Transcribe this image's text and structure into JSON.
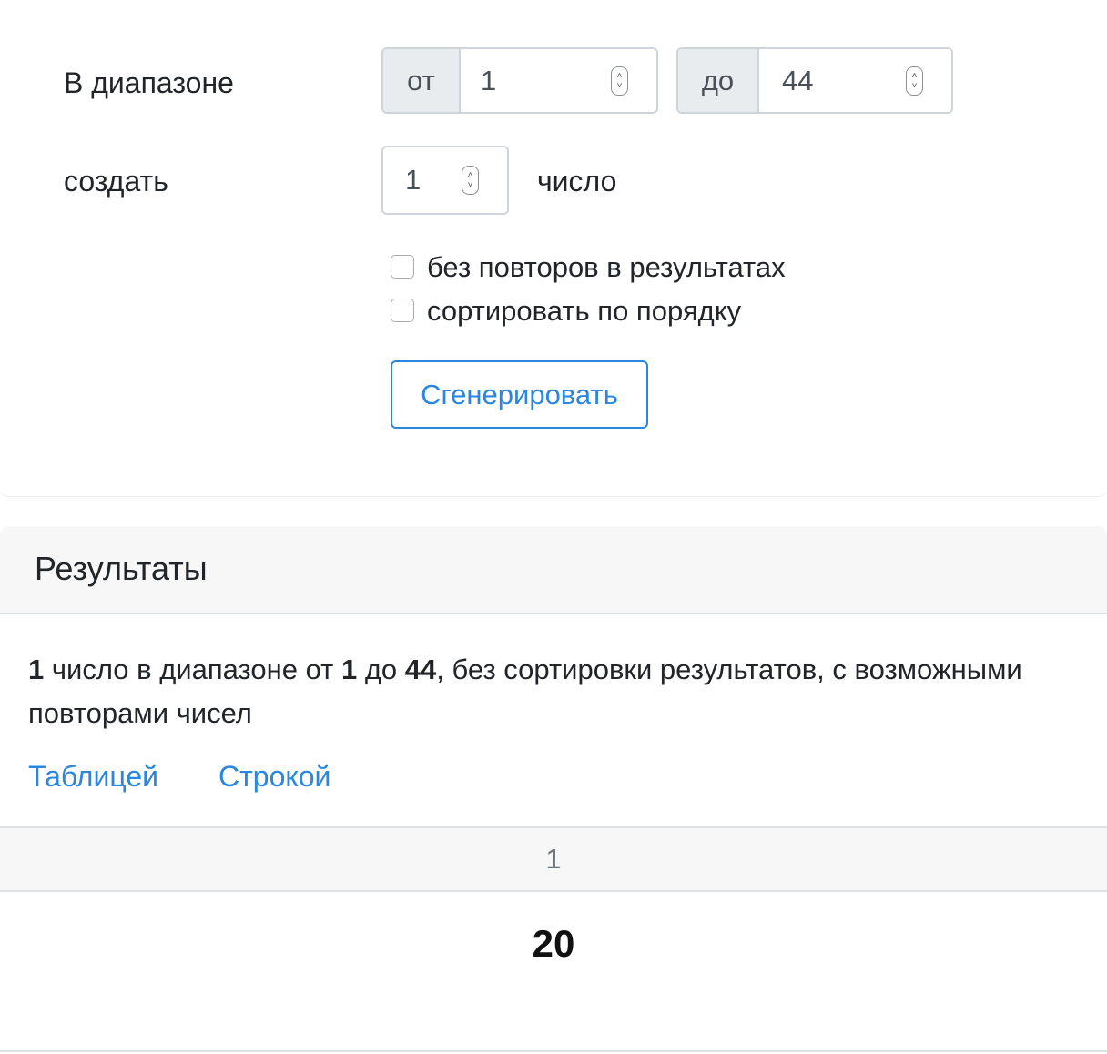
{
  "form": {
    "range_label": "В диапазоне",
    "from_addon": "от",
    "from_value": "1",
    "to_addon": "до",
    "to_value": "44",
    "create_label": "создать",
    "count_value": "1",
    "count_suffix": "число",
    "checkbox_unique": {
      "label": "без повторов в результатах",
      "checked": false
    },
    "checkbox_sort": {
      "label": "сортировать по порядку",
      "checked": false
    },
    "generate_button": "Сгенерировать"
  },
  "results": {
    "title": "Результаты",
    "summary": {
      "count": "1",
      "text1": " число в диапазоне от ",
      "from": "1",
      "text2": " до ",
      "to": "44",
      "text3": ", без сортировки результатов, с возможными повторами чисел"
    },
    "tabs": [
      {
        "label": "Таблицей"
      },
      {
        "label": "Строкой"
      }
    ],
    "table": {
      "header": "1",
      "value": "20"
    }
  },
  "colors": {
    "accent": "#2a86de",
    "addon_bg": "#e9ecef",
    "header_bg": "#f7f7f7"
  }
}
